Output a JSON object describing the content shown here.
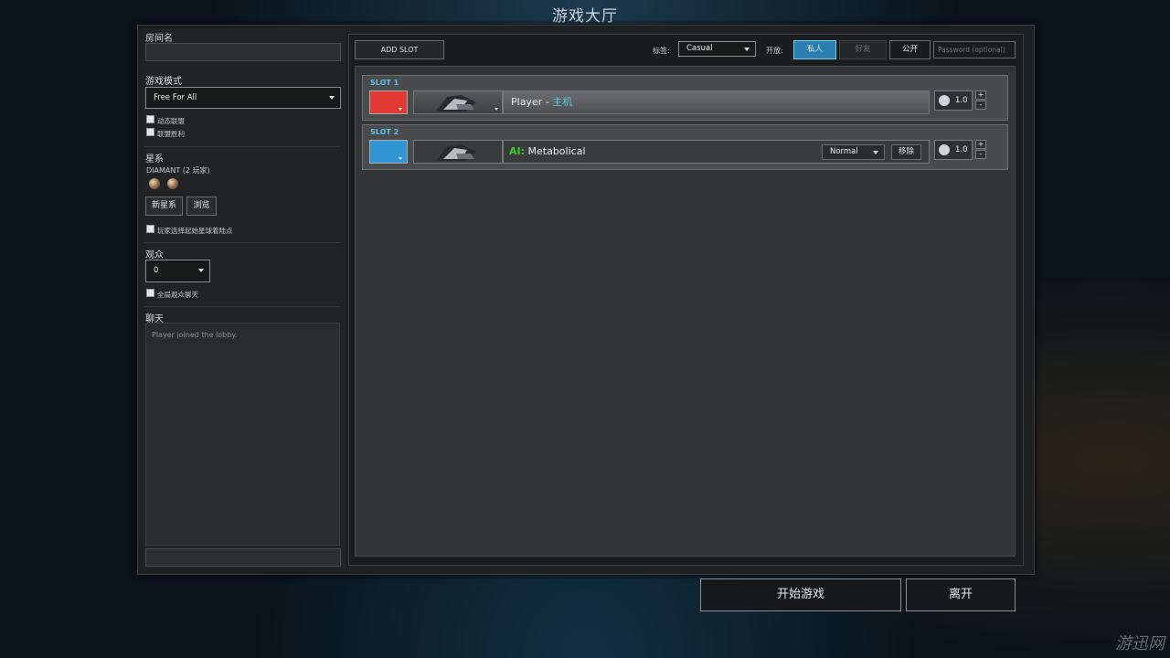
{
  "title": "游戏大厅",
  "left": {
    "room_name_label": "房间名",
    "room_name_value": "",
    "game_mode_label": "游戏模式",
    "game_mode_value": "Free For All",
    "opt_dynamic_alliance": "动态联盟",
    "opt_alliance_victory": "联盟胜利",
    "galaxy_label": "星系",
    "galaxy_name": "DIAMANT (2 玩家)",
    "new_galaxy_btn": "新星系",
    "browse_btn": "浏览",
    "opt_choose_start": "玩家选择起始星球着陆点",
    "spectators_label": "观众",
    "spectators_value": "0",
    "opt_global_spectator_chat": "全局观众聊天",
    "chat_label": "聊天",
    "chat_messages": [
      "Player joined the lobby."
    ],
    "chat_input": ""
  },
  "toolbar": {
    "add_slot": "ADD SLOT",
    "tag_label": "标签:",
    "tag_value": "Casual",
    "open_label": "开放:",
    "privacy_options": [
      "私人",
      "好友",
      "公开"
    ],
    "privacy_selected": "私人",
    "password_placeholder": "Password (optional)"
  },
  "slots": [
    {
      "label": "SLOT 1",
      "color": "#e03a32",
      "name": "Player",
      "host_sep": " - ",
      "host_tag": "主机",
      "handicap": "1.0"
    },
    {
      "label": "SLOT 2",
      "color": "#3196d3",
      "ai_prefix": "AI:",
      "name": "Metabolical",
      "difficulty": "Normal",
      "remove": "移除",
      "handicap": "1.0"
    }
  ],
  "stepper": {
    "plus": "+",
    "minus": "-"
  },
  "footer": {
    "start": "开始游戏",
    "leave": "离开"
  },
  "watermark": "游迅网",
  "colors": {
    "accent_cyan": "#5ec3e8",
    "ai_green": "#34d21c",
    "selected_btn": "#2a7fb0"
  }
}
